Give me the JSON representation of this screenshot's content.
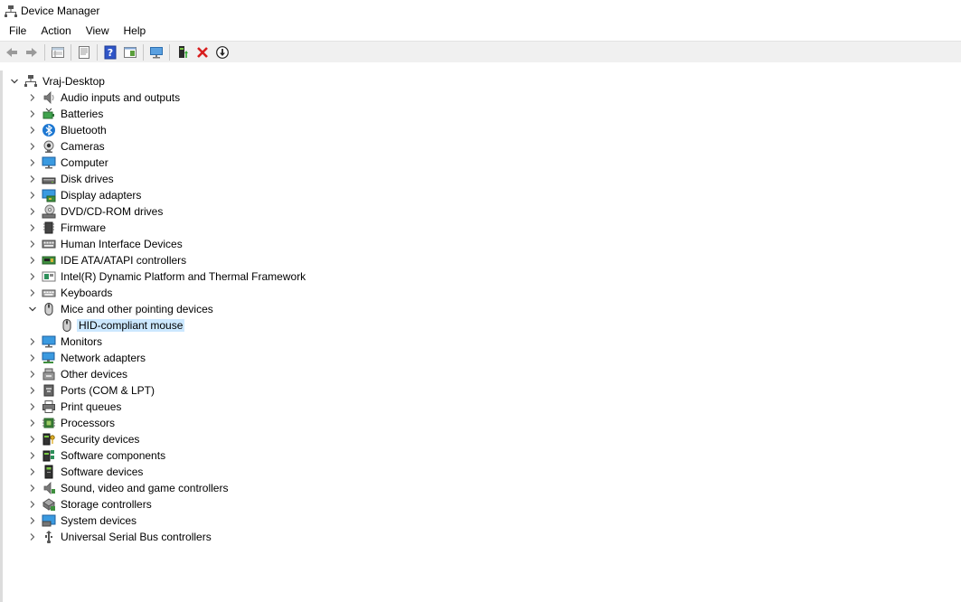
{
  "window": {
    "title": "Device Manager"
  },
  "menu": [
    "File",
    "Action",
    "View",
    "Help"
  ],
  "toolbar": [
    {
      "name": "back-arrow-icon"
    },
    {
      "name": "forward-arrow-icon"
    },
    {
      "sep": true
    },
    {
      "name": "properties-grid-icon"
    },
    {
      "sep": true
    },
    {
      "name": "properties-sheet-icon"
    },
    {
      "sep": true
    },
    {
      "name": "help-icon"
    },
    {
      "name": "view-panel-icon"
    },
    {
      "sep": true
    },
    {
      "name": "scan-monitor-icon"
    },
    {
      "sep": true
    },
    {
      "name": "update-driver-icon"
    },
    {
      "name": "uninstall-x-icon"
    },
    {
      "name": "download-circle-icon"
    }
  ],
  "tree": {
    "root": {
      "label": "Vraj-Desktop",
      "icon": "computer-root-icon",
      "expanded": true
    },
    "categories": [
      {
        "label": "Audio inputs and outputs",
        "icon": "speaker-icon"
      },
      {
        "label": "Batteries",
        "icon": "battery-icon"
      },
      {
        "label": "Bluetooth",
        "icon": "bluetooth-icon"
      },
      {
        "label": "Cameras",
        "icon": "camera-icon"
      },
      {
        "label": "Computer",
        "icon": "monitor-icon"
      },
      {
        "label": "Disk drives",
        "icon": "disk-drive-icon"
      },
      {
        "label": "Display adapters",
        "icon": "display-adapter-icon"
      },
      {
        "label": "DVD/CD-ROM drives",
        "icon": "dvd-drive-icon"
      },
      {
        "label": "Firmware",
        "icon": "firmware-chip-icon"
      },
      {
        "label": "Human Interface Devices",
        "icon": "hid-keyboard-icon"
      },
      {
        "label": "IDE ATA/ATAPI controllers",
        "icon": "ide-controller-icon"
      },
      {
        "label": "Intel(R) Dynamic Platform and Thermal Framework",
        "icon": "platform-framework-icon"
      },
      {
        "label": "Keyboards",
        "icon": "keyboard-icon"
      },
      {
        "label": "Mice and other pointing devices",
        "icon": "mouse-icon",
        "expanded": true,
        "children": [
          {
            "label": "HID-compliant mouse",
            "icon": "mouse-icon",
            "selected": true
          }
        ]
      },
      {
        "label": "Monitors",
        "icon": "monitor-icon"
      },
      {
        "label": "Network adapters",
        "icon": "network-adapter-icon"
      },
      {
        "label": "Other devices",
        "icon": "other-devices-icon"
      },
      {
        "label": "Ports (COM & LPT)",
        "icon": "port-icon"
      },
      {
        "label": "Print queues",
        "icon": "printer-icon"
      },
      {
        "label": "Processors",
        "icon": "processor-icon"
      },
      {
        "label": "Security devices",
        "icon": "security-device-icon"
      },
      {
        "label": "Software components",
        "icon": "software-component-icon"
      },
      {
        "label": "Software devices",
        "icon": "software-device-icon"
      },
      {
        "label": "Sound, video and game controllers",
        "icon": "sound-controller-icon"
      },
      {
        "label": "Storage controllers",
        "icon": "storage-controller-icon"
      },
      {
        "label": "System devices",
        "icon": "system-devices-icon"
      },
      {
        "label": "Universal Serial Bus controllers",
        "icon": "usb-icon"
      }
    ]
  },
  "colors": {
    "selection": "#cce8ff",
    "toolbar_bg": "#f0f0f0",
    "accent_blue": "#1e78d2"
  }
}
